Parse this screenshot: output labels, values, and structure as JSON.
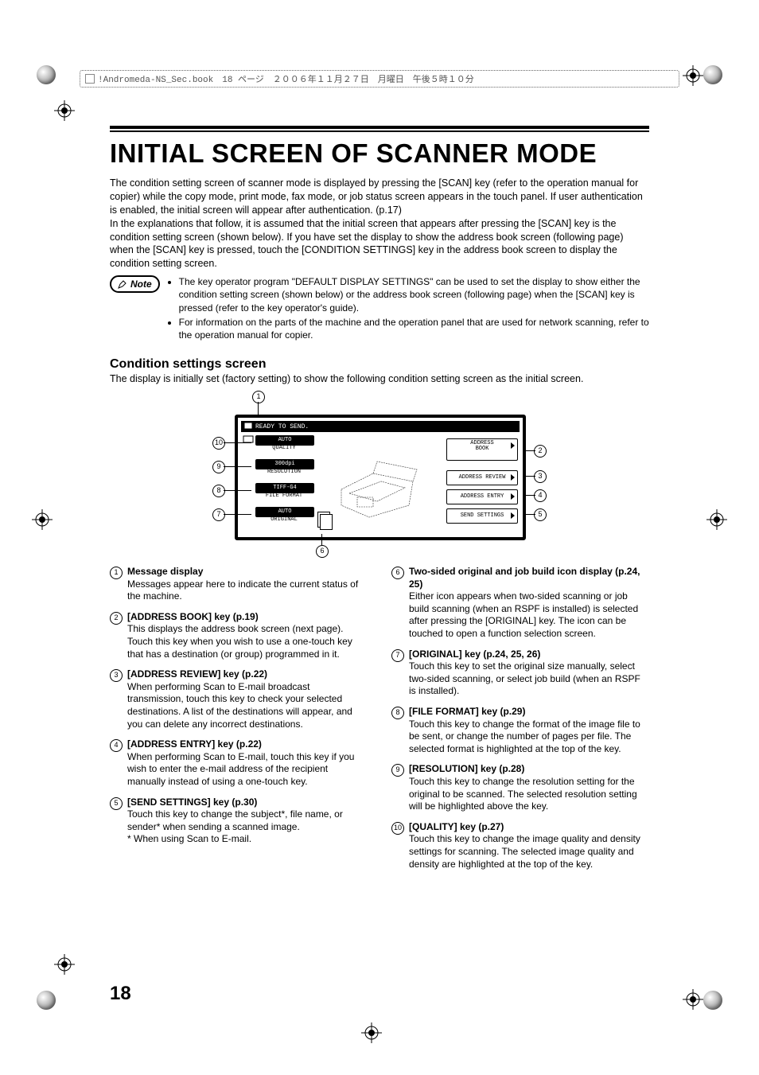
{
  "header_strip": "!Andromeda-NS_Sec.book　18 ページ　２００６年１１月２７日　月曜日　午後５時１０分",
  "title": "INITIAL SCREEN OF SCANNER MODE",
  "intro": "The condition setting screen of scanner mode is displayed by pressing the [SCAN] key (refer to the operation manual for copier) while the copy mode, print mode, fax mode, or job status screen appears in the touch panel. If user authentication is enabled, the initial screen will appear after authentication. (p.17)\nIn the explanations that follow, it is assumed that the initial screen that appears after pressing the [SCAN] key is the condition setting screen (shown below). If you have set the display to show the address book screen (following page) when the [SCAN] key is pressed, touch the [CONDITION SETTINGS] key in the address book screen to display the condition setting screen.",
  "note_label": "Note",
  "note_bullets": [
    "The key operator program \"DEFAULT DISPLAY SETTINGS\" can be used to set the display to show either the condition setting screen (shown below) or the address book screen (following page) when the [SCAN] key is pressed (refer to the key operator's guide).",
    "For information on the parts of the machine and the operation panel that are used for network scanning, refer to the operation manual for copier."
  ],
  "subtitle": "Condition settings screen",
  "subtitle_desc": "The display is initially set (factory setting) to show the following condition setting screen as the initial screen.",
  "panel": {
    "message": "READY TO SEND.",
    "left": [
      {
        "value": "AUTO",
        "label": "QUALITY"
      },
      {
        "value": "300dpi",
        "label": "RESOLUTION"
      },
      {
        "value": "TIFF-G4",
        "label": "FILE FORMAT"
      },
      {
        "value": "AUTO",
        "label": "ORIGINAL"
      }
    ],
    "right": [
      {
        "label_top": "ADDRESS",
        "label_bottom": "BOOK"
      },
      {
        "label": "ADDRESS REVIEW"
      },
      {
        "label": "ADDRESS ENTRY"
      },
      {
        "label": "SEND SETTINGS"
      }
    ]
  },
  "callouts": [
    "1",
    "2",
    "3",
    "4",
    "5",
    "6",
    "7",
    "8",
    "9",
    "10"
  ],
  "items_left": [
    {
      "num": "1",
      "title": "Message display",
      "body": "Messages appear here to indicate the current status of the machine."
    },
    {
      "num": "2",
      "title": "[ADDRESS BOOK] key (p.19)",
      "body": "This displays the address book screen (next page). Touch this key when you wish to use a one-touch key that has a destination (or group) programmed in it."
    },
    {
      "num": "3",
      "title": "[ADDRESS REVIEW] key (p.22)",
      "body": "When performing Scan to E-mail broadcast transmission, touch this key to check your selected destinations. A list of the destinations will appear, and you can delete any incorrect destinations."
    },
    {
      "num": "4",
      "title": "[ADDRESS ENTRY] key (p.22)",
      "body": "When performing Scan to E-mail, touch this key if you wish to enter the e-mail address of the recipient manually instead of using a one-touch key."
    },
    {
      "num": "5",
      "title": "[SEND SETTINGS] key (p.30)",
      "body": "Touch this key to change the subject*, file name, or sender* when sending a scanned image.\n* When using Scan to E-mail."
    }
  ],
  "items_right": [
    {
      "num": "6",
      "title": "Two-sided original and job build icon display (p.24, 25)",
      "body": "Either icon appears when two-sided scanning or job build scanning (when an RSPF is installed) is selected after pressing the [ORIGINAL] key. The icon can be touched to open a function selection screen."
    },
    {
      "num": "7",
      "title": "[ORIGINAL] key (p.24, 25, 26)",
      "body": "Touch this key to set the original size manually, select two-sided scanning, or select job build (when an RSPF is installed)."
    },
    {
      "num": "8",
      "title": "[FILE FORMAT] key (p.29)",
      "body": "Touch this key to change the format of the image file to be sent, or change the number of pages per file. The selected format is highlighted at the top of the key."
    },
    {
      "num": "9",
      "title": "[RESOLUTION] key (p.28)",
      "body": "Touch this key to change the resolution setting for the original to be scanned. The selected resolution setting will be highlighted above the key."
    },
    {
      "num": "10",
      "title": "[QUALITY] key (p.27)",
      "body": "Touch this key to change the image quality and density settings for scanning. The selected image quality and density are highlighted at the top of the key."
    }
  ],
  "page_number": "18"
}
